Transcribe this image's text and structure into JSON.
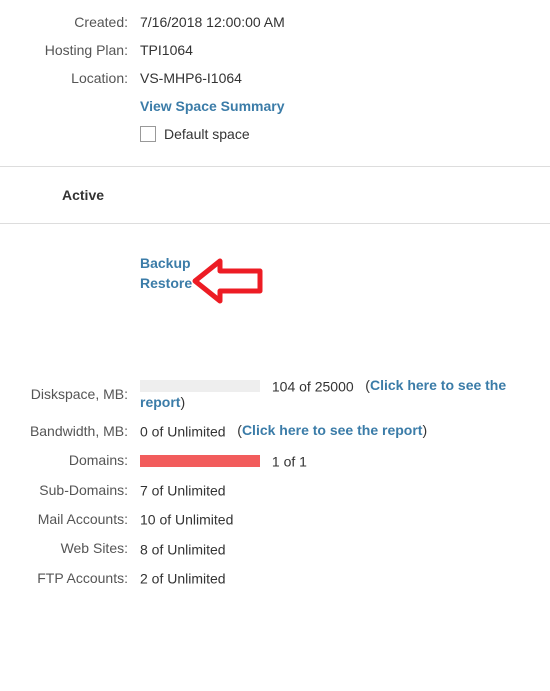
{
  "info": {
    "created_label": "Created:",
    "created_value": "7/16/2018 12:00:00 AM",
    "hosting_plan_label": "Hosting Plan:",
    "hosting_plan_value": "TPI1064",
    "location_label": "Location:",
    "location_value": "VS-MHP6-I1064",
    "view_summary_link": "View Space Summary",
    "default_space_label": "Default space"
  },
  "status": {
    "active_heading": "Active"
  },
  "actions": {
    "backup_link": "Backup",
    "restore_link": "Restore"
  },
  "quotas": {
    "diskspace_label": "Diskspace, MB:",
    "diskspace_text": "104 of 25000",
    "diskspace_fill_pct": 0,
    "report_link": "Click here to see the report",
    "bandwidth_label": "Bandwidth, MB:",
    "bandwidth_text": "0 of Unlimited",
    "domains_label": "Domains:",
    "domains_text": "1 of 1",
    "domains_fill_pct": 100,
    "subdomains_label": "Sub-Domains:",
    "subdomains_text": "7 of Unlimited",
    "mail_label": "Mail Accounts:",
    "mail_text": "10 of Unlimited",
    "websites_label": "Web Sites:",
    "websites_text": "8 of Unlimited",
    "ftp_label": "FTP Accounts:",
    "ftp_text": "2 of Unlimited"
  },
  "colors": {
    "link": "#3b7ca8",
    "bar_fill": "#f25c5c",
    "arrow": "#ed1c24"
  }
}
